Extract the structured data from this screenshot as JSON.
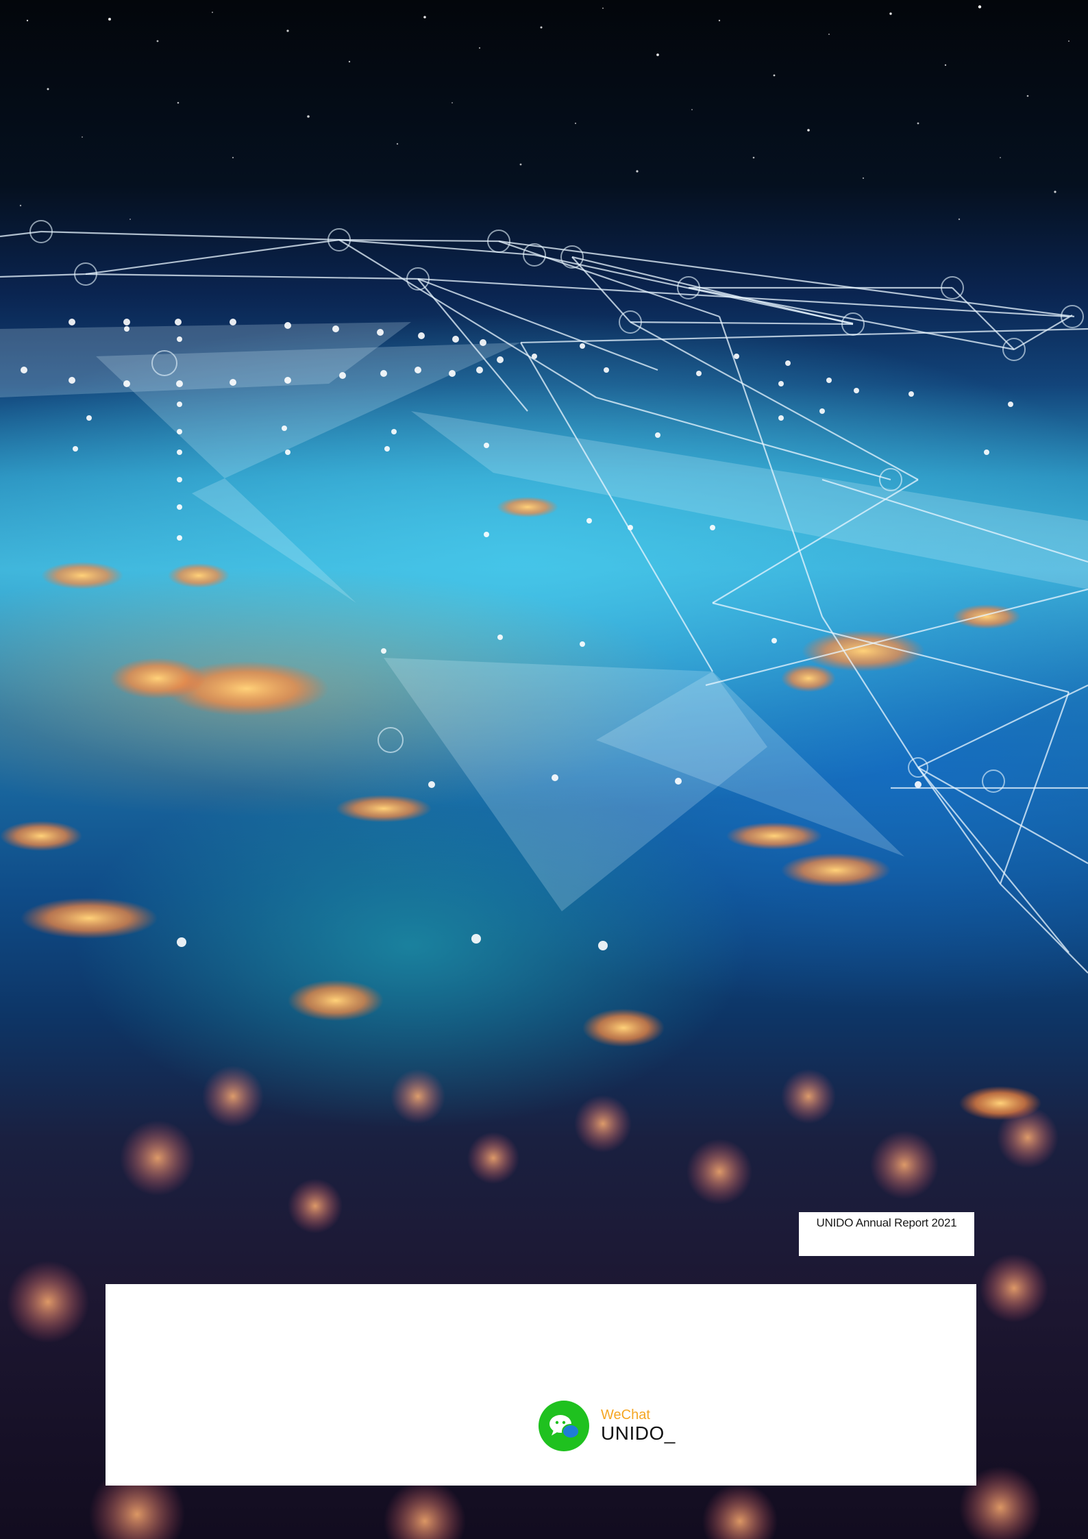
{
  "cover": {
    "report_title": "UNIDO Annual Report 2021"
  },
  "contact": {
    "wechat_label": "WeChat",
    "wechat_handle": "UNIDO_"
  },
  "colors": {
    "wechat_green": "#1fc11f",
    "wechat_label_orange": "#f5a623",
    "panel_background": "#ffffff"
  },
  "icons": {
    "wechat": "wechat-icon"
  }
}
